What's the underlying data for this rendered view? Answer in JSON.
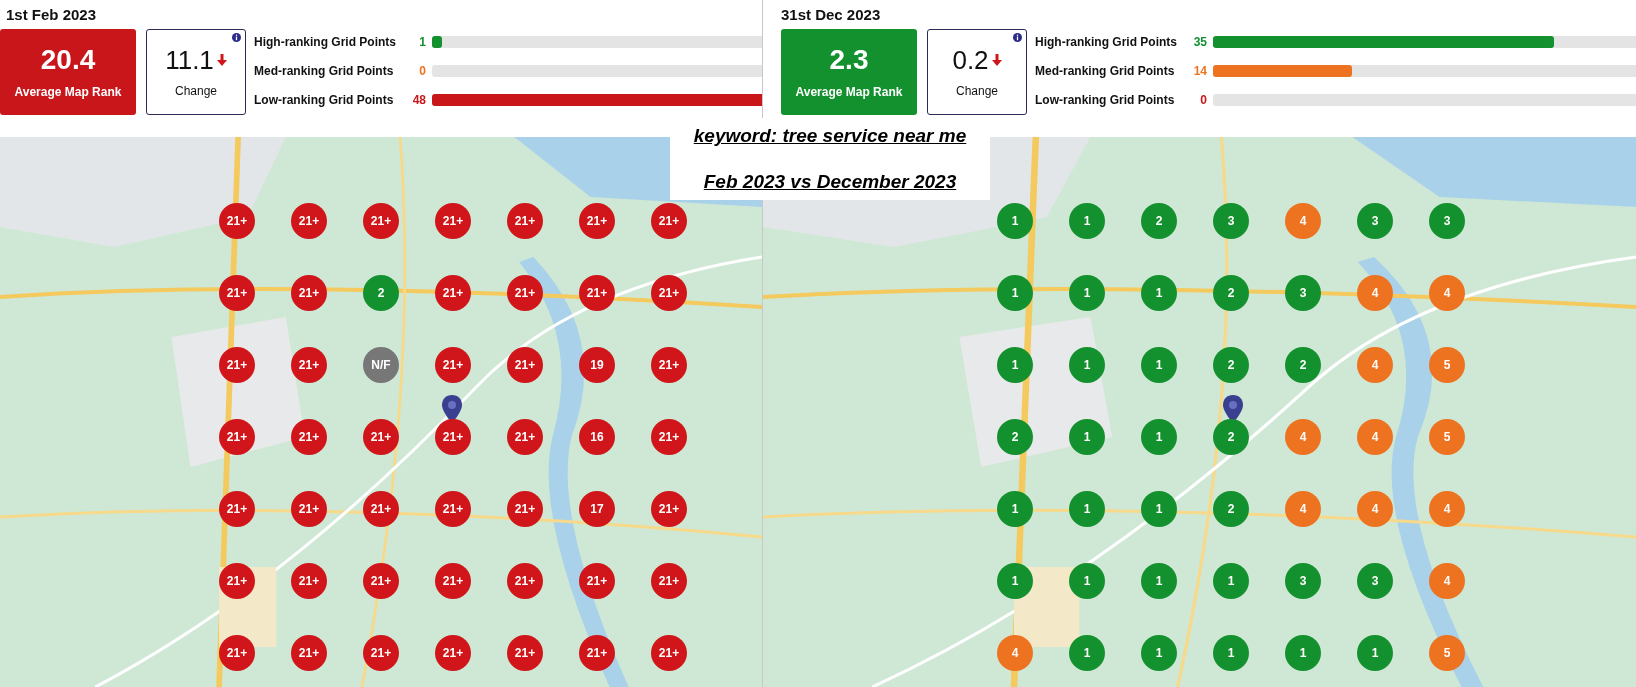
{
  "panels": [
    {
      "date": "1st Feb 2023",
      "average": {
        "value": "20.4",
        "label": "Average Map Rank",
        "color": "#c8161b"
      },
      "change": {
        "value": "11.1",
        "label": "Change"
      },
      "metrics": [
        {
          "label": "High-ranking Grid Points",
          "count": "1",
          "level": 0.02,
          "color": "#14912f"
        },
        {
          "label": "Med-ranking Grid Points",
          "count": "0",
          "level": 0,
          "color": "#ee7320"
        },
        {
          "label": "Low-ranking Grid Points",
          "count": "48",
          "level": 0.98,
          "color": "#c8161b"
        }
      ],
      "grid": [
        {
          "rank": "21+",
          "color": "#d0161b"
        },
        {
          "rank": "21+",
          "color": "#d0161b"
        },
        {
          "rank": "21+",
          "color": "#d0161b"
        },
        {
          "rank": "21+",
          "color": "#d0161b"
        },
        {
          "rank": "21+",
          "color": "#d0161b"
        },
        {
          "rank": "21+",
          "color": "#d0161b"
        },
        {
          "rank": "21+",
          "color": "#d0161b"
        },
        {
          "rank": "21+",
          "color": "#d0161b"
        },
        {
          "rank": "21+",
          "color": "#d0161b"
        },
        {
          "rank": "2",
          "color": "#14912f"
        },
        {
          "rank": "21+",
          "color": "#d0161b"
        },
        {
          "rank": "21+",
          "color": "#d0161b"
        },
        {
          "rank": "21+",
          "color": "#d0161b"
        },
        {
          "rank": "21+",
          "color": "#d0161b"
        },
        {
          "rank": "21+",
          "color": "#d0161b"
        },
        {
          "rank": "21+",
          "color": "#d0161b"
        },
        {
          "rank": "N/F",
          "color": "#777777"
        },
        {
          "rank": "21+",
          "color": "#d0161b"
        },
        {
          "rank": "21+",
          "color": "#d0161b"
        },
        {
          "rank": "19",
          "color": "#d0161b"
        },
        {
          "rank": "21+",
          "color": "#d0161b"
        },
        {
          "rank": "21+",
          "color": "#d0161b"
        },
        {
          "rank": "21+",
          "color": "#d0161b"
        },
        {
          "rank": "21+",
          "color": "#d0161b"
        },
        {
          "rank": "21+",
          "color": "#d0161b"
        },
        {
          "rank": "21+",
          "color": "#d0161b"
        },
        {
          "rank": "16",
          "color": "#d0161b"
        },
        {
          "rank": "21+",
          "color": "#d0161b"
        },
        {
          "rank": "21+",
          "color": "#d0161b"
        },
        {
          "rank": "21+",
          "color": "#d0161b"
        },
        {
          "rank": "21+",
          "color": "#d0161b"
        },
        {
          "rank": "21+",
          "color": "#d0161b"
        },
        {
          "rank": "21+",
          "color": "#d0161b"
        },
        {
          "rank": "17",
          "color": "#d0161b"
        },
        {
          "rank": "21+",
          "color": "#d0161b"
        },
        {
          "rank": "21+",
          "color": "#d0161b"
        },
        {
          "rank": "21+",
          "color": "#d0161b"
        },
        {
          "rank": "21+",
          "color": "#d0161b"
        },
        {
          "rank": "21+",
          "color": "#d0161b"
        },
        {
          "rank": "21+",
          "color": "#d0161b"
        },
        {
          "rank": "21+",
          "color": "#d0161b"
        },
        {
          "rank": "21+",
          "color": "#d0161b"
        },
        {
          "rank": "21+",
          "color": "#d0161b"
        },
        {
          "rank": "21+",
          "color": "#d0161b"
        },
        {
          "rank": "21+",
          "color": "#d0161b"
        },
        {
          "rank": "21+",
          "color": "#d0161b"
        },
        {
          "rank": "21+",
          "color": "#d0161b"
        },
        {
          "rank": "21+",
          "color": "#d0161b"
        },
        {
          "rank": "21+",
          "color": "#d0161b"
        }
      ]
    },
    {
      "date": "31st Dec 2023",
      "average": {
        "value": "2.3",
        "label": "Average Map Rank",
        "color": "#14912f"
      },
      "change": {
        "value": "0.2",
        "label": "Change"
      },
      "metrics": [
        {
          "label": "High-ranking Grid Points",
          "count": "35",
          "level": 0.71,
          "color": "#14912f"
        },
        {
          "label": "Med-ranking Grid Points",
          "count": "14",
          "level": 0.29,
          "color": "#ee7320"
        },
        {
          "label": "Low-ranking Grid Points",
          "count": "0",
          "level": 0,
          "color": "#c8161b"
        }
      ],
      "grid": [
        {
          "rank": "1",
          "color": "#14912f"
        },
        {
          "rank": "1",
          "color": "#14912f"
        },
        {
          "rank": "2",
          "color": "#14912f"
        },
        {
          "rank": "3",
          "color": "#14912f"
        },
        {
          "rank": "4",
          "color": "#ee7320"
        },
        {
          "rank": "3",
          "color": "#14912f"
        },
        {
          "rank": "3",
          "color": "#14912f"
        },
        {
          "rank": "1",
          "color": "#14912f"
        },
        {
          "rank": "1",
          "color": "#14912f"
        },
        {
          "rank": "1",
          "color": "#14912f"
        },
        {
          "rank": "2",
          "color": "#14912f"
        },
        {
          "rank": "3",
          "color": "#14912f"
        },
        {
          "rank": "4",
          "color": "#ee7320"
        },
        {
          "rank": "4",
          "color": "#ee7320"
        },
        {
          "rank": "1",
          "color": "#14912f"
        },
        {
          "rank": "1",
          "color": "#14912f"
        },
        {
          "rank": "1",
          "color": "#14912f"
        },
        {
          "rank": "2",
          "color": "#14912f"
        },
        {
          "rank": "2",
          "color": "#14912f"
        },
        {
          "rank": "4",
          "color": "#ee7320"
        },
        {
          "rank": "5",
          "color": "#ee7320"
        },
        {
          "rank": "2",
          "color": "#14912f"
        },
        {
          "rank": "1",
          "color": "#14912f"
        },
        {
          "rank": "1",
          "color": "#14912f"
        },
        {
          "rank": "2",
          "color": "#14912f"
        },
        {
          "rank": "4",
          "color": "#ee7320"
        },
        {
          "rank": "4",
          "color": "#ee7320"
        },
        {
          "rank": "5",
          "color": "#ee7320"
        },
        {
          "rank": "1",
          "color": "#14912f"
        },
        {
          "rank": "1",
          "color": "#14912f"
        },
        {
          "rank": "1",
          "color": "#14912f"
        },
        {
          "rank": "2",
          "color": "#14912f"
        },
        {
          "rank": "4",
          "color": "#ee7320"
        },
        {
          "rank": "4",
          "color": "#ee7320"
        },
        {
          "rank": "4",
          "color": "#ee7320"
        },
        {
          "rank": "1",
          "color": "#14912f"
        },
        {
          "rank": "1",
          "color": "#14912f"
        },
        {
          "rank": "1",
          "color": "#14912f"
        },
        {
          "rank": "1",
          "color": "#14912f"
        },
        {
          "rank": "3",
          "color": "#14912f"
        },
        {
          "rank": "3",
          "color": "#14912f"
        },
        {
          "rank": "4",
          "color": "#ee7320"
        },
        {
          "rank": "4",
          "color": "#ee7320"
        },
        {
          "rank": "1",
          "color": "#14912f"
        },
        {
          "rank": "1",
          "color": "#14912f"
        },
        {
          "rank": "1",
          "color": "#14912f"
        },
        {
          "rank": "1",
          "color": "#14912f"
        },
        {
          "rank": "1",
          "color": "#14912f"
        },
        {
          "rank": "5",
          "color": "#ee7320"
        }
      ]
    }
  ],
  "caption": {
    "keyword": "keyword: tree service near me",
    "comparison": "Feb 2023 vs December 2023"
  }
}
